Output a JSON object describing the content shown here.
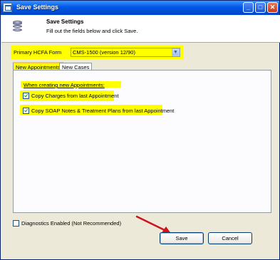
{
  "window": {
    "title": "Save Settings",
    "controls": {
      "minimize": "_",
      "maximize": "□",
      "close": "✕"
    }
  },
  "header": {
    "title": "Save Settings",
    "subtitle": "Fill out the fields below and click Save.",
    "icon": "database-icon"
  },
  "form": {
    "hcfa_label": "Primary HCFA Form",
    "hcfa_value": "CMS-1500 (version 12/90)"
  },
  "tabs": [
    {
      "label": "New Appointments",
      "active": true
    },
    {
      "label": "New Cases",
      "active": false
    }
  ],
  "appointments": {
    "heading": "When creating new Appointments:",
    "options": [
      {
        "label": "Copy Charges from last Appointment",
        "checked": true
      },
      {
        "label": "Copy SOAP Notes & Treatment Plans from last Appointment",
        "checked": true
      }
    ]
  },
  "diagnostics": {
    "label": "Diagnostics Enabled (Not Recommended)",
    "checked": false
  },
  "buttons": {
    "save": "Save",
    "cancel": "Cancel"
  },
  "colors": {
    "highlight": "#ffff00",
    "annotation_arrow": "#d0121b",
    "titlebar": "#0058e6"
  }
}
